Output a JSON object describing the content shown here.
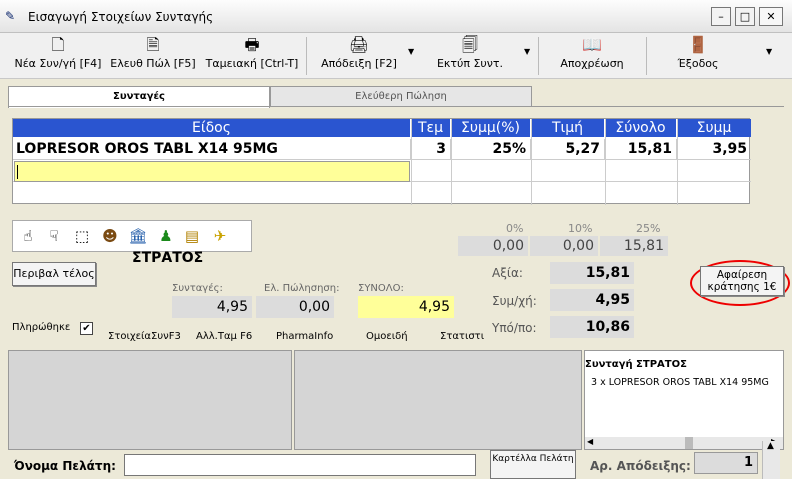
{
  "window": {
    "title": "Εισαγωγή Στοιχείων Συνταγής"
  },
  "toolbar": [
    {
      "label": "Νέα Συν/γή [F4]",
      "icon": "new-doc-icon",
      "glyph": "🗋"
    },
    {
      "label": "Ελευθ Πώλ [F5]",
      "icon": "free-sale-icon",
      "glyph": "🗎"
    },
    {
      "label": "Ταμειακή [Ctrl-T]",
      "icon": "cash-register-icon",
      "glyph": "🖶"
    },
    {
      "label": "Απόδειξη [F2]",
      "icon": "printer-icon",
      "glyph": "🖨"
    },
    {
      "label": "Εκτύπ Συντ.",
      "icon": "print-prescription-icon",
      "glyph": "🗐"
    },
    {
      "label": "Αποχρέωση",
      "icon": "book-icon",
      "glyph": "📖"
    },
    {
      "label": "Έξοδος",
      "icon": "exit-door-icon",
      "glyph": "🚪"
    }
  ],
  "tabs": [
    "Συνταγές",
    "Ελεύθερη Πώληση"
  ],
  "grid": {
    "headers": [
      "Είδος",
      "Τεμ",
      "Συμμ(%)",
      "Τιμή",
      "Σύνολο",
      "Συμμ"
    ],
    "rows": [
      [
        "LOPRESOR OROS TABL X14 95MG",
        "3",
        "25%",
        "5,27",
        "15,81",
        "3,95"
      ]
    ]
  },
  "patient": {
    "insurer": "ΣΤΡΑΤΟΣ"
  },
  "buttons": {
    "perivali": "Περιβαλ τέλος",
    "afairesi": "Αφαίρεση κράτησης 1€",
    "kartella": "Καρτέλλα Πελάτη"
  },
  "totals": {
    "syntages_label": "Συνταγές:",
    "syntages": "4,95",
    "el_label": "Ελ. Πώλησηση:",
    "el": "0,00",
    "synolo_label": "ΣΥΝΟΛΟ:",
    "synolo": "4,95",
    "axia_label": "Αξία:",
    "axia": "15,81",
    "symxi_label": "Συμ/χή:",
    "symxi": "4,95",
    "ypolo_label": "Υπό/πο:",
    "ypolo": "10,86"
  },
  "pct": [
    {
      "p": "0%",
      "v": "0,00"
    },
    {
      "p": "10%",
      "v": "0,00"
    },
    {
      "p": "25%",
      "v": "15,81"
    }
  ],
  "paid": {
    "label": "Πληρώθηκε",
    "checked": "✔"
  },
  "links": [
    "ΣτοιχείαΣυνF3",
    "Αλλ.Ταμ F6",
    "PharmaInfo",
    "Ομοειδή",
    "Στατιστι"
  ],
  "tree": {
    "root": "Συνταγή ΣΤΡΑΤΟΣ",
    "item": "3 x LOPRESOR OROS TABL X14 95MG"
  },
  "customer": {
    "label": "Όνομα Πελάτη:",
    "value": ""
  },
  "receipt": {
    "label": "Αρ. Απόδειξης:",
    "value": "1"
  }
}
